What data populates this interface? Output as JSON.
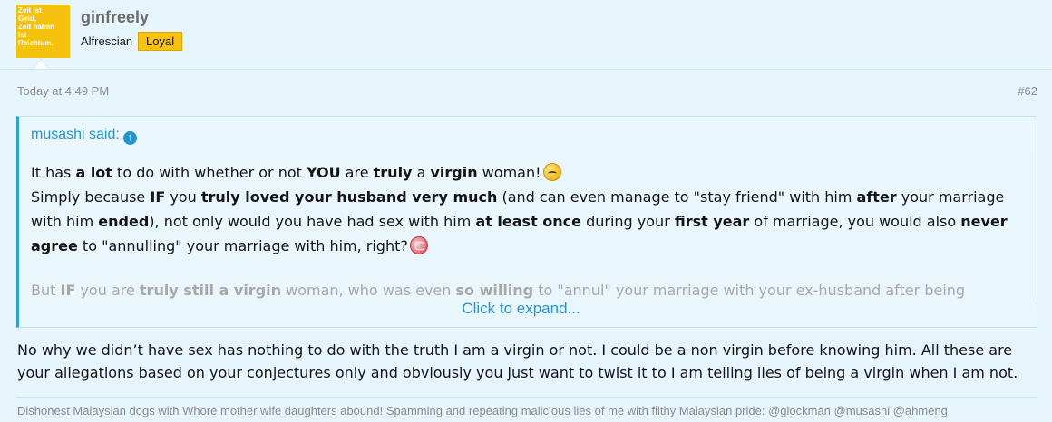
{
  "avatar": {
    "text": "Zeit ist\nGeld,\nZeit haben\nist\nReichtum.",
    "color": "#f4c20d"
  },
  "user": {
    "name": "ginfreely",
    "title": "Alfrescian",
    "banner": "Loyal",
    "banner_color": "#f9c30b"
  },
  "meta": {
    "date": "Today at 4:49 PM",
    "post_number": "#62"
  },
  "quote": {
    "author": "musashi said:",
    "arrow_icon": "arrow-up-circle-icon",
    "p1": {
      "t1": "It has ",
      "b1": "a lot",
      "t2": " to do with whether or not ",
      "b2": "YOU",
      "t3": " are ",
      "b3": "truly",
      "t4": " a ",
      "b4": "virgin",
      "t5": " woman!"
    },
    "p2": {
      "t1": "Simply because ",
      "b1": "IF",
      "t2": " you ",
      "b2": "truly loved your husband very much",
      "t3": " (and can even manage to \"stay friend\" with him ",
      "b3": "after",
      "t4": " your marriage with him ",
      "b4": "ended",
      "t5": "), not only would you have had sex with him ",
      "b5": "at least once",
      "t6": " during your ",
      "b6": "first year",
      "t7": " of marriage, you would also ",
      "b7": "never agree",
      "t8": " to \"annulling\" your marriage with him, right?"
    },
    "p3": {
      "t1": "But ",
      "b1": "IF",
      "t2": " you are ",
      "b2": "truly still a virgin",
      "t3": " woman, who was even ",
      "b3": "so willing",
      "t4": " to \"annul\" your marriage with your ex-husband after being married \"for years\":"
    },
    "expand_label": "Click to expand..."
  },
  "message": "No why we didn’t have sex has nothing to do with the truth I am a virgin or not. I could be a non virgin before knowing him. All these are your allegations based on your conjectures only and obviously you just want to twist it to I am telling lies of being a virgin when I am not.",
  "signature": "Dishonest Malaysian dogs with Whore mother wife daughters abound! Spamming and repeating malicious lies of me with filthy Malaysian pride: @glockman @musashi @ahmeng",
  "colors": {
    "background": "#e6f5fb",
    "link": "#2294d4",
    "quote_border": "#2f9fd8",
    "muted": "#8c8c8c"
  }
}
